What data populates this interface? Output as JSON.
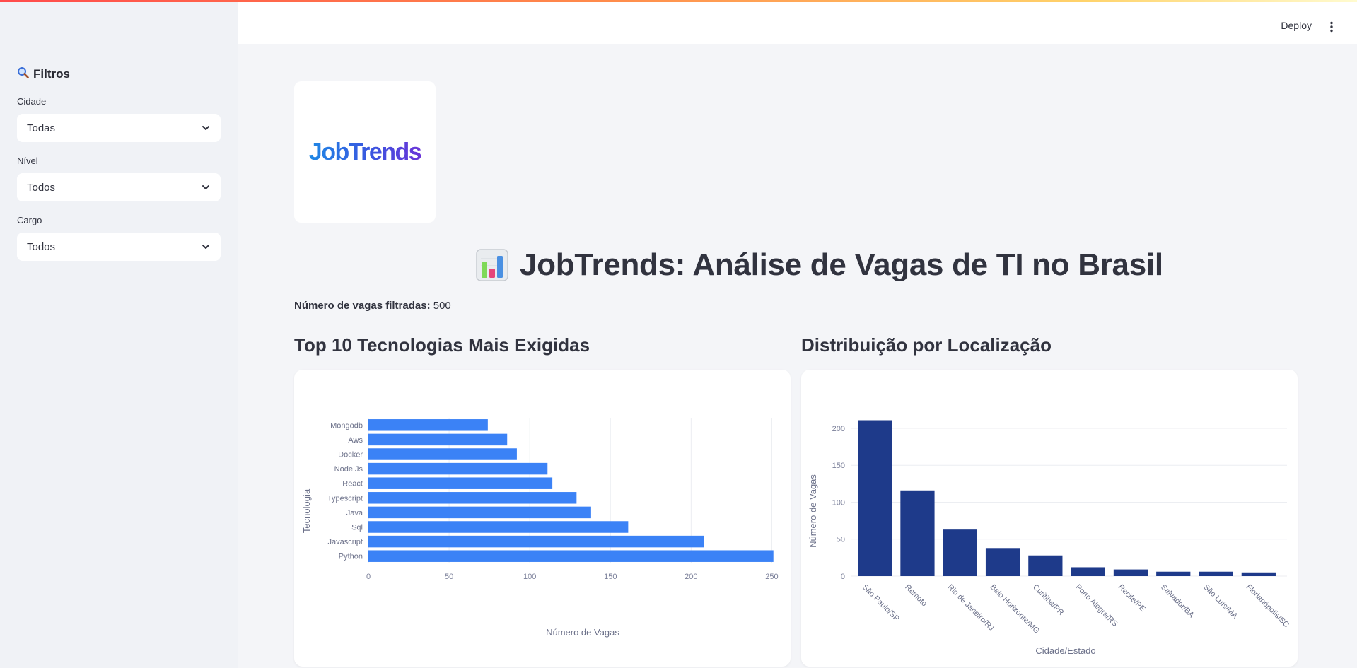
{
  "header": {
    "deploy_label": "Deploy"
  },
  "sidebar": {
    "title": "Filtros",
    "filters": [
      {
        "label": "Cidade",
        "value": "Todas"
      },
      {
        "label": "Nível",
        "value": "Todos"
      },
      {
        "label": "Cargo",
        "value": "Todos"
      }
    ]
  },
  "main": {
    "logo_text": "JobTrends",
    "title": "JobTrends: Análise de Vagas de TI no Brasil",
    "count_label": "Número de vagas filtradas:",
    "count_value": "500",
    "sections": [
      {
        "title": "Top 10 Tecnologias Mais Exigidas"
      },
      {
        "title": "Distribuição por Localização"
      }
    ]
  },
  "chart_data": [
    {
      "type": "bar",
      "orientation": "horizontal",
      "categories": [
        "Python",
        "Javascript",
        "Sql",
        "Java",
        "Typescript",
        "React",
        "Node.Js",
        "Docker",
        "Aws",
        "Mongodb"
      ],
      "values": [
        251,
        208,
        161,
        138,
        129,
        114,
        111,
        92,
        86,
        74
      ],
      "xlabel": "Número de Vagas",
      "ylabel": "Tecnologia",
      "xlim": [
        0,
        252
      ],
      "xticks": [
        0,
        50,
        100,
        150,
        200,
        250
      ],
      "grid": true,
      "color": "#3b82f6"
    },
    {
      "type": "bar",
      "orientation": "vertical",
      "categories": [
        "São Paulo/SP",
        "Remoto",
        "Rio de Janeiro/RJ",
        "Belo Horizonte/MG",
        "Curitiba/PR",
        "Porto Alegre/RS",
        "Recife/PE",
        "Salvador/BA",
        "São Luís/MA",
        "Florianópolis/SC"
      ],
      "values": [
        211,
        116,
        63,
        38,
        28,
        12,
        9,
        6,
        6,
        5
      ],
      "xlabel": "Cidade/Estado",
      "ylabel": "Número de Vagas",
      "ylim": [
        0,
        222
      ],
      "yticks": [
        0,
        50,
        100,
        150,
        200
      ],
      "grid": true,
      "color": "#1e3a8a"
    }
  ]
}
